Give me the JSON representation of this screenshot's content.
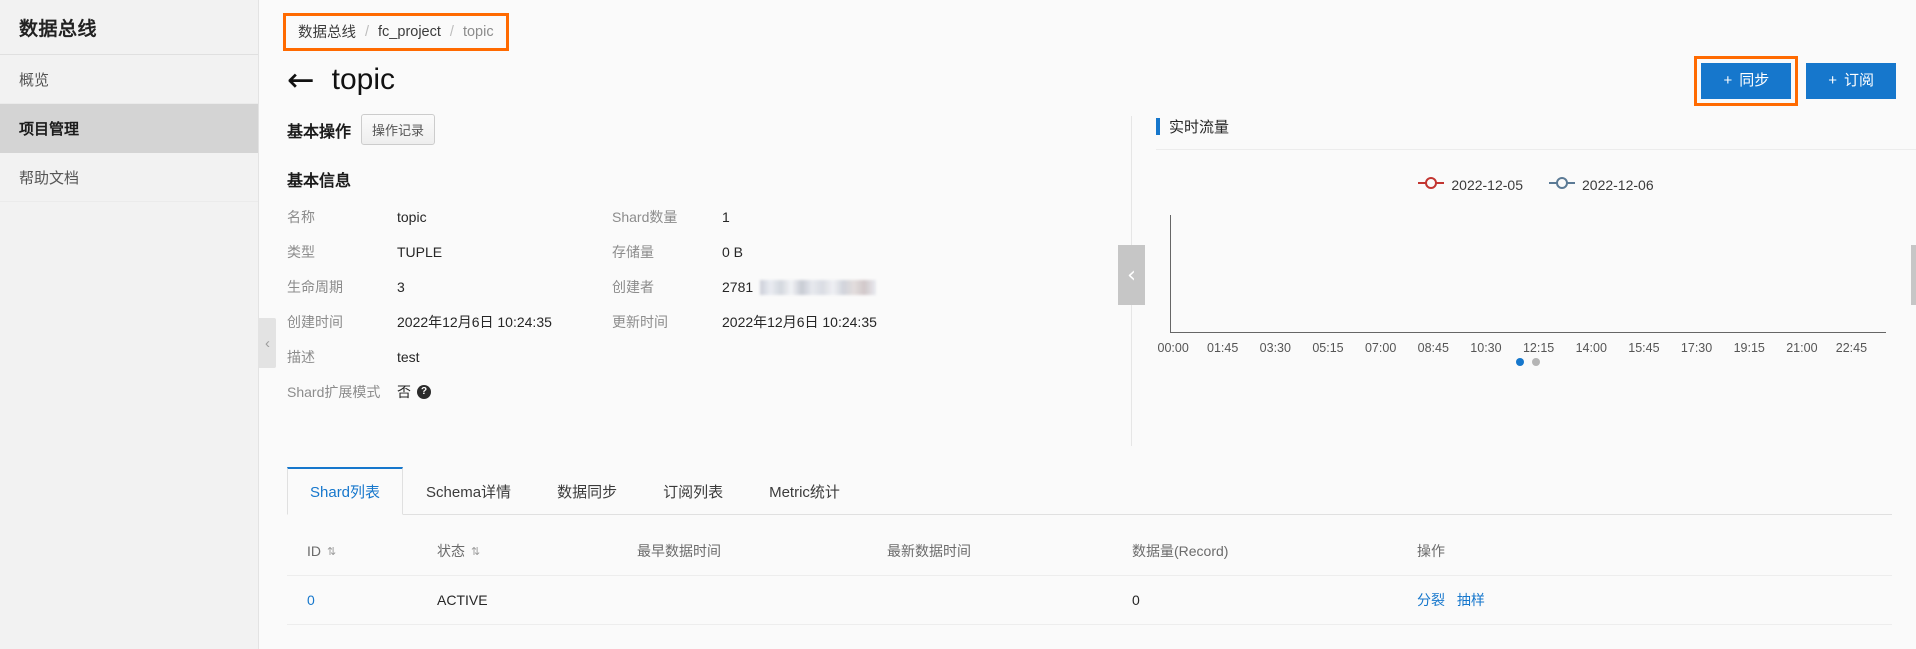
{
  "sidebar": {
    "brand": "数据总线",
    "items": [
      {
        "label": "概览",
        "active": false
      },
      {
        "label": "项目管理",
        "active": true
      },
      {
        "label": "帮助文档",
        "active": false
      }
    ]
  },
  "breadcrumb": {
    "items": [
      "数据总线",
      "fc_project",
      "topic"
    ],
    "separator": "/",
    "highlight_color": "#ff6a00"
  },
  "header": {
    "back_icon": "←",
    "title": "topic",
    "actions": [
      {
        "label": "同步",
        "icon": "+",
        "highlighted": true
      },
      {
        "label": "订阅",
        "icon": "+",
        "highlighted": false
      }
    ]
  },
  "basic_ops": {
    "title": "基本操作",
    "record_button": "操作记录"
  },
  "basic_info": {
    "title": "基本信息",
    "rows": [
      {
        "label": "名称",
        "value": "topic",
        "label2": "Shard数量",
        "value2": "1"
      },
      {
        "label": "类型",
        "value": "TUPLE",
        "label2": "存储量",
        "value2": "0 B"
      },
      {
        "label": "生命周期",
        "value": "3",
        "label2": "创建者",
        "value2": "2781",
        "value2_redacted": true
      },
      {
        "label": "创建时间",
        "value": "2022年12月6日 10:24:35",
        "label2": "更新时间",
        "value2": "2022年12月6日 10:24:35"
      },
      {
        "label": "描述",
        "value": "test",
        "label2": "",
        "value2": ""
      },
      {
        "label": "Shard扩展模式",
        "value": "否",
        "has_help": true,
        "label2": "",
        "value2": ""
      }
    ],
    "collapse_icon": "‹"
  },
  "chart_panel": {
    "title": "实时流量",
    "accent": "#1677cc",
    "nav_left": "‹",
    "nav_right": "›",
    "pagination": [
      {
        "active": true
      },
      {
        "active": false
      }
    ]
  },
  "chart_data": {
    "type": "line",
    "title": "实时流量",
    "xlabel": "",
    "ylabel": "",
    "grid": false,
    "legend_position": "top-center",
    "x": [
      "00:00",
      "01:45",
      "03:30",
      "05:15",
      "07:00",
      "08:45",
      "10:30",
      "12:15",
      "14:00",
      "15:45",
      "17:30",
      "19:15",
      "21:00",
      "22:45"
    ],
    "series": [
      {
        "name": "2022-12-05",
        "color": "#c23531",
        "values": []
      },
      {
        "name": "2022-12-06",
        "color": "#5b7a95",
        "values": []
      }
    ],
    "note": "Plot area is empty — axes rendered with no data points"
  },
  "tabs": [
    {
      "label": "Shard列表",
      "active": true
    },
    {
      "label": "Schema详情",
      "active": false
    },
    {
      "label": "数据同步",
      "active": false
    },
    {
      "label": "订阅列表",
      "active": false
    },
    {
      "label": "Metric统计",
      "active": false
    }
  ],
  "table": {
    "columns": [
      {
        "label": "ID",
        "sortable": true
      },
      {
        "label": "状态",
        "sortable": true
      },
      {
        "label": "最早数据时间",
        "sortable": false
      },
      {
        "label": "最新数据时间",
        "sortable": false
      },
      {
        "label": "数据量(Record)",
        "sortable": false
      },
      {
        "label": "操作",
        "sortable": false
      }
    ],
    "sort_glyph": "⇅",
    "rows": [
      {
        "id": "0",
        "state": "ACTIVE",
        "earliest": "",
        "latest": "",
        "records": "0",
        "ops": [
          "分裂",
          "抽样"
        ]
      }
    ]
  }
}
